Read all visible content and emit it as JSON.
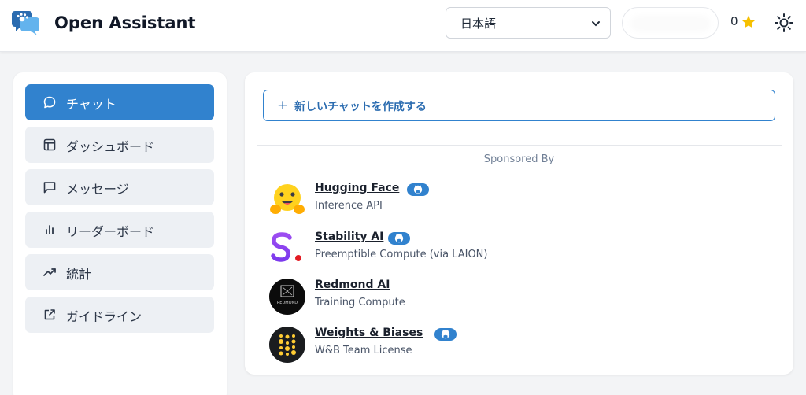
{
  "header": {
    "app_title": "Open Assistant",
    "language": "日本語",
    "score": "0"
  },
  "sidebar": {
    "items": [
      {
        "label": "チャット",
        "icon": "chat-bubble-icon"
      },
      {
        "label": "ダッシュボード",
        "icon": "layout-icon"
      },
      {
        "label": "メッセージ",
        "icon": "message-square-icon"
      },
      {
        "label": "リーダーボード",
        "icon": "bar-chart-icon"
      },
      {
        "label": "統計",
        "icon": "trending-up-icon"
      },
      {
        "label": "ガイドライン",
        "icon": "external-link-icon"
      }
    ]
  },
  "main": {
    "new_chat_plus": "+",
    "new_chat_label": "新しいチャットを作成する",
    "sponsored_by": "Sponsored By",
    "sponsors": [
      {
        "name": "Hugging Face",
        "desc": "Inference API",
        "github": true
      },
      {
        "name": "Stability AI",
        "desc": "Preemptible Compute (via LAION)",
        "github": true
      },
      {
        "name": "Redmond AI",
        "desc": "Training Compute",
        "github": false,
        "logo_text": "REDMOND"
      },
      {
        "name": "Weights & Biases",
        "desc": "W&B Team License",
        "github": true
      }
    ]
  },
  "colors": {
    "accent": "#3182ce",
    "star": "#f6c000"
  }
}
